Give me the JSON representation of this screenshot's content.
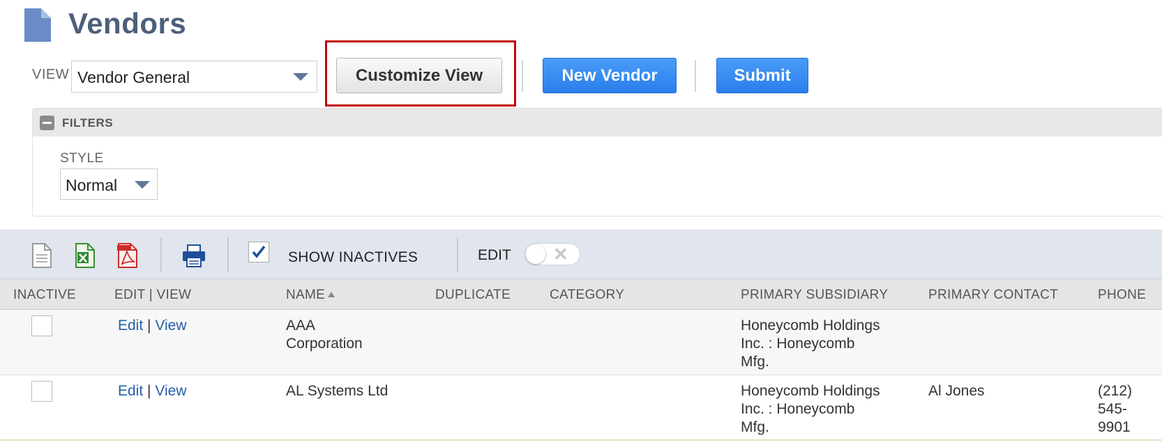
{
  "header": {
    "title": "Vendors",
    "view_label": "VIEW",
    "view_value": "Vendor General",
    "customize_label": "Customize View",
    "new_label": "New Vendor",
    "submit_label": "Submit"
  },
  "filters": {
    "label": "FILTERS",
    "style_label": "STYLE",
    "style_value": "Normal"
  },
  "toolbar": {
    "show_inactives_label": "SHOW INACTIVES",
    "show_inactives_checked": true,
    "edit_label": "EDIT",
    "edit_toggle_on": false
  },
  "table": {
    "columns": [
      "INACTIVE",
      "EDIT | VIEW",
      "NAME",
      "DUPLICATE",
      "CATEGORY",
      "PRIMARY SUBSIDIARY",
      "PRIMARY CONTACT",
      "PHONE"
    ],
    "edit_label": "Edit",
    "separator": "|",
    "view_label": "View",
    "rows": [
      {
        "name_lines": [
          "AAA",
          "Corporation"
        ],
        "subsidiary_lines": [
          "Honeycomb Holdings",
          "Inc. : Honeycomb",
          "Mfg."
        ],
        "contact": "",
        "phone_lines": []
      },
      {
        "name_lines": [
          "AL Systems Ltd"
        ],
        "subsidiary_lines": [
          "Honeycomb Holdings",
          "Inc. : Honeycomb",
          "Mfg."
        ],
        "contact": "Al Jones",
        "phone_lines": [
          "(212)",
          "545-",
          "9901"
        ]
      }
    ]
  },
  "colors": {
    "title": "#4d5f79",
    "primary_button": "#2a7eeb",
    "highlight": "#c00000",
    "link": "#255fa8"
  },
  "icons": [
    "page-icon",
    "new-document-icon",
    "excel-export-icon",
    "pdf-export-icon",
    "print-icon",
    "checkmark-icon",
    "collapse-minus-icon",
    "dropdown-arrow-icon",
    "close-x-icon"
  ]
}
